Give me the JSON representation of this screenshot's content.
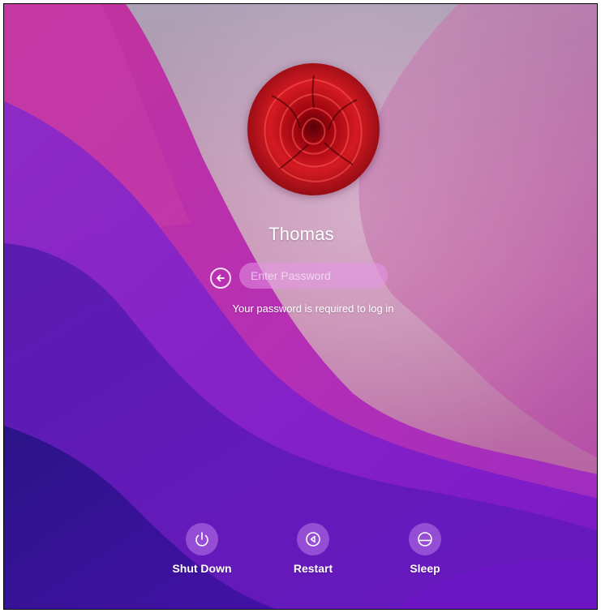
{
  "user": {
    "name": "Thomas"
  },
  "login": {
    "password_placeholder": "Enter Password",
    "hint": "Your password is required to log in"
  },
  "actions": [
    {
      "label": "Shut Down",
      "icon": "power-icon"
    },
    {
      "label": "Restart",
      "icon": "restart-icon"
    },
    {
      "label": "Sleep",
      "icon": "sleep-icon"
    }
  ],
  "colors": {
    "wallpaper_top": "#b79bb0",
    "wallpaper_magenta": "#c33bb2",
    "wallpaper_purple": "#7d1fc4",
    "wallpaper_deep": "#3b1596",
    "avatar_rose": "#c4121b"
  }
}
